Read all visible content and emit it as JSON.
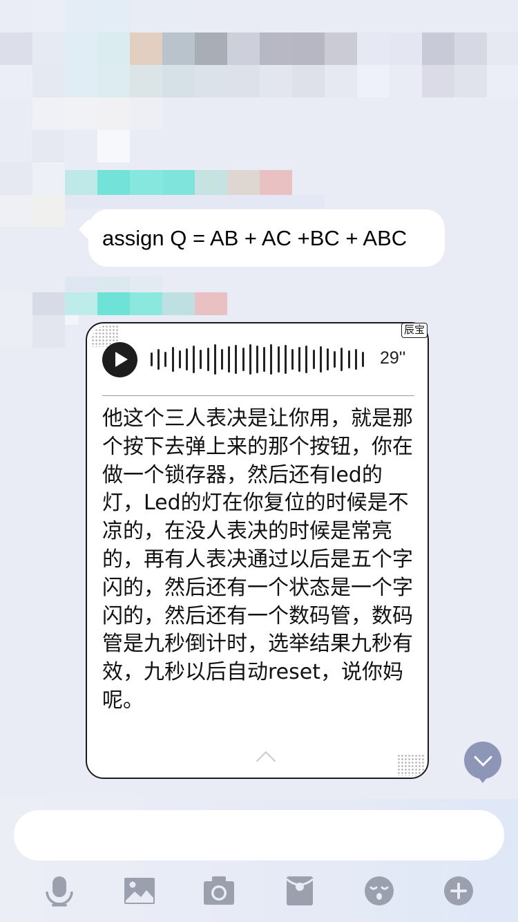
{
  "messages": {
    "text_message": "assign Q = AB + AC +BC + ABC",
    "voice_message": {
      "tag": "辰宝",
      "duration": "29''",
      "transcript": "他这个三人表决是让你用，就是那个按下去弹上来的那个按钮，你在做一个锁存器，然后还有led的灯，Led的灯在你复位的时候是不凉的，在没人表决的时候是常亮的，再有人表决通过以后是五个字闪的，然后还有一个状态是一个字闪的，然后还有一个数码管，数码管是九秒倒计时，选举结果九秒有效，九秒以后自动reset，说你妈呢。"
    }
  },
  "input": {
    "value": "",
    "placeholder": ""
  },
  "toolbar": {
    "icons": [
      "microphone-icon",
      "image-icon",
      "camera-icon",
      "red-packet-icon",
      "emoji-icon",
      "plus-icon"
    ]
  },
  "colors": {
    "background": "#e9ebf5",
    "icon_gray": "#9aa0ad",
    "scroll_button": "#8e96b8"
  }
}
